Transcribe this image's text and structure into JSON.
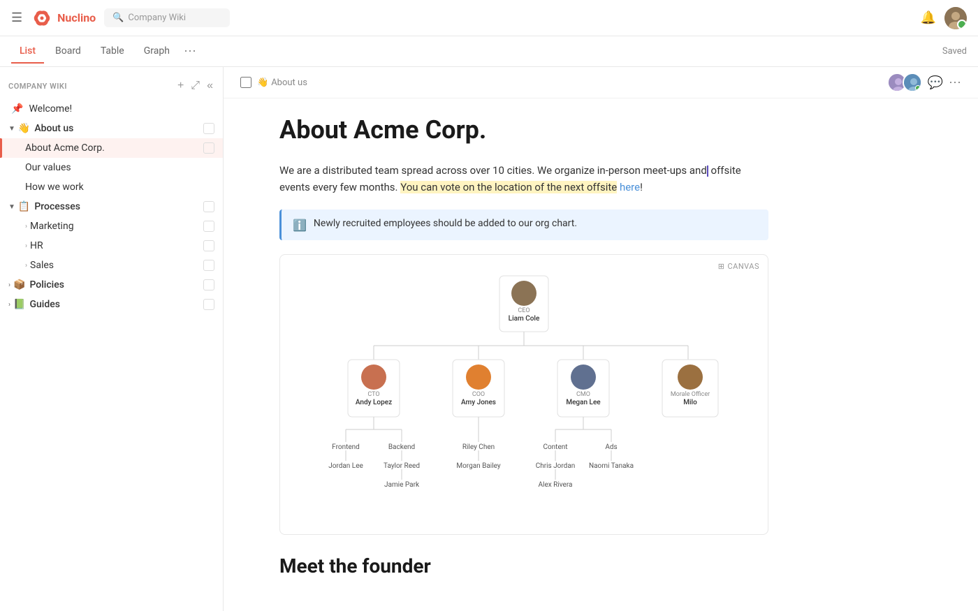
{
  "app": {
    "name": "Nuclino",
    "search_placeholder": "Company Wiki"
  },
  "tabs": [
    {
      "label": "List",
      "active": true
    },
    {
      "label": "Board",
      "active": false
    },
    {
      "label": "Table",
      "active": false
    },
    {
      "label": "Graph",
      "active": false
    }
  ],
  "saved_label": "Saved",
  "sidebar": {
    "section_title": "COMPANY WIKI",
    "items": [
      {
        "id": "welcome",
        "label": "Welcome!",
        "pinned": true,
        "indent": 0
      },
      {
        "id": "about-us",
        "label": "About us",
        "emoji": "👋",
        "expanded": true,
        "indent": 0
      },
      {
        "id": "about-acme",
        "label": "About Acme Corp.",
        "indent": 1,
        "active": true
      },
      {
        "id": "our-values",
        "label": "Our values",
        "indent": 1
      },
      {
        "id": "how-we-work",
        "label": "How we work",
        "indent": 1
      },
      {
        "id": "processes",
        "label": "Processes",
        "emoji": "📋",
        "expanded": true,
        "indent": 0
      },
      {
        "id": "marketing",
        "label": "Marketing",
        "indent": 1,
        "has_children": true
      },
      {
        "id": "hr",
        "label": "HR",
        "indent": 1,
        "has_children": true
      },
      {
        "id": "sales",
        "label": "Sales",
        "indent": 1,
        "has_children": true
      },
      {
        "id": "policies",
        "label": "Policies",
        "emoji": "📦",
        "indent": 0,
        "has_children": true
      },
      {
        "id": "guides",
        "label": "Guides",
        "emoji": "📗",
        "indent": 0,
        "has_children": true
      }
    ]
  },
  "breadcrumb": {
    "emoji": "👋",
    "label": "About us"
  },
  "document": {
    "title": "About Acme Corp.",
    "body_text_1": "We are a distributed team spread across over 10 cities. We organize in-person meet-ups and offsite events every few months.",
    "body_text_2": "You can vote on the location of the next offsite",
    "link_text": "here",
    "info_text": "Newly recruited employees should be added to our org chart.",
    "canvas_label": "CANVAS",
    "meet_founder_title": "Meet the founder"
  },
  "org_chart": {
    "ceo": {
      "role": "CEO",
      "name": "Liam Cole"
    },
    "l2": [
      {
        "role": "CTO",
        "name": "Andy Lopez"
      },
      {
        "role": "COO",
        "name": "Amy Jones"
      },
      {
        "role": "CMO",
        "name": "Megan Lee"
      },
      {
        "role": "Morale Officer",
        "name": "Milo"
      }
    ],
    "l3": [
      {
        "label": "Frontend",
        "parent": "CTO"
      },
      {
        "label": "Backend",
        "parent": "CTO"
      },
      {
        "label": "Riley Chen",
        "parent": "COO"
      },
      {
        "label": "Content",
        "parent": "CMO"
      },
      {
        "label": "Ads",
        "parent": "CMO"
      }
    ],
    "l4": [
      {
        "label": "Jordan Lee",
        "parent": "Frontend"
      },
      {
        "label": "Taylor Reed",
        "parent": "Backend"
      },
      {
        "label": "Morgan Bailey",
        "parent": "Riley Chen"
      },
      {
        "label": "Chris Jordan",
        "parent": "Content"
      },
      {
        "label": "Naomi Tanaka",
        "parent": "Ads"
      },
      {
        "label": "Jamie Park",
        "parent": "Taylor Reed"
      },
      {
        "label": "Alex Rivera",
        "parent": "Chris Jordan"
      }
    ]
  },
  "colors": {
    "accent": "#e85d4a",
    "link": "#4a90d9",
    "info_bg": "#EBF4FF",
    "active_bg": "#fef2f0"
  }
}
